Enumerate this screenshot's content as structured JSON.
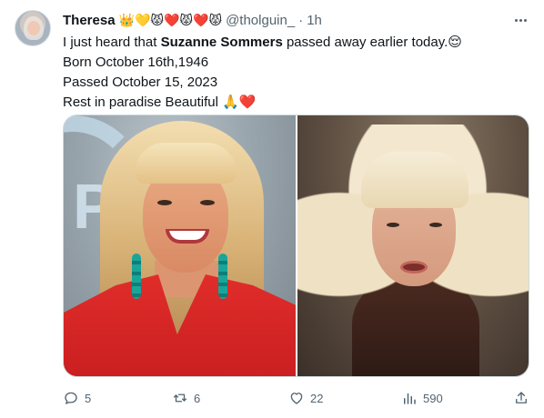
{
  "user": {
    "name": "Theresa",
    "emojis": "👑💛😾❤️😾❤️😾",
    "handle": "@tholguin_",
    "separator": "·",
    "time": "1h"
  },
  "tweet": {
    "line1_prefix": "I just heard that ",
    "line1_bold": "Suzanne Sommers",
    "line1_suffix": " passed away earlier today.😌",
    "line2": "Born October 16th,1946",
    "line3": "Passed October 15, 2023",
    "line4": "Rest in paradise Beautiful 🙏❤️"
  },
  "actions": {
    "replies": "5",
    "retweets": "6",
    "likes": "22",
    "views": "590"
  },
  "icons": {
    "more": "more-horizontal-icon",
    "reply": "reply-icon",
    "retweet": "retweet-icon",
    "like": "heart-icon",
    "views": "views-icon",
    "share": "share-icon"
  },
  "colors": {
    "text": "#0f1419",
    "secondary": "#536471",
    "border": "#cfd9de"
  }
}
